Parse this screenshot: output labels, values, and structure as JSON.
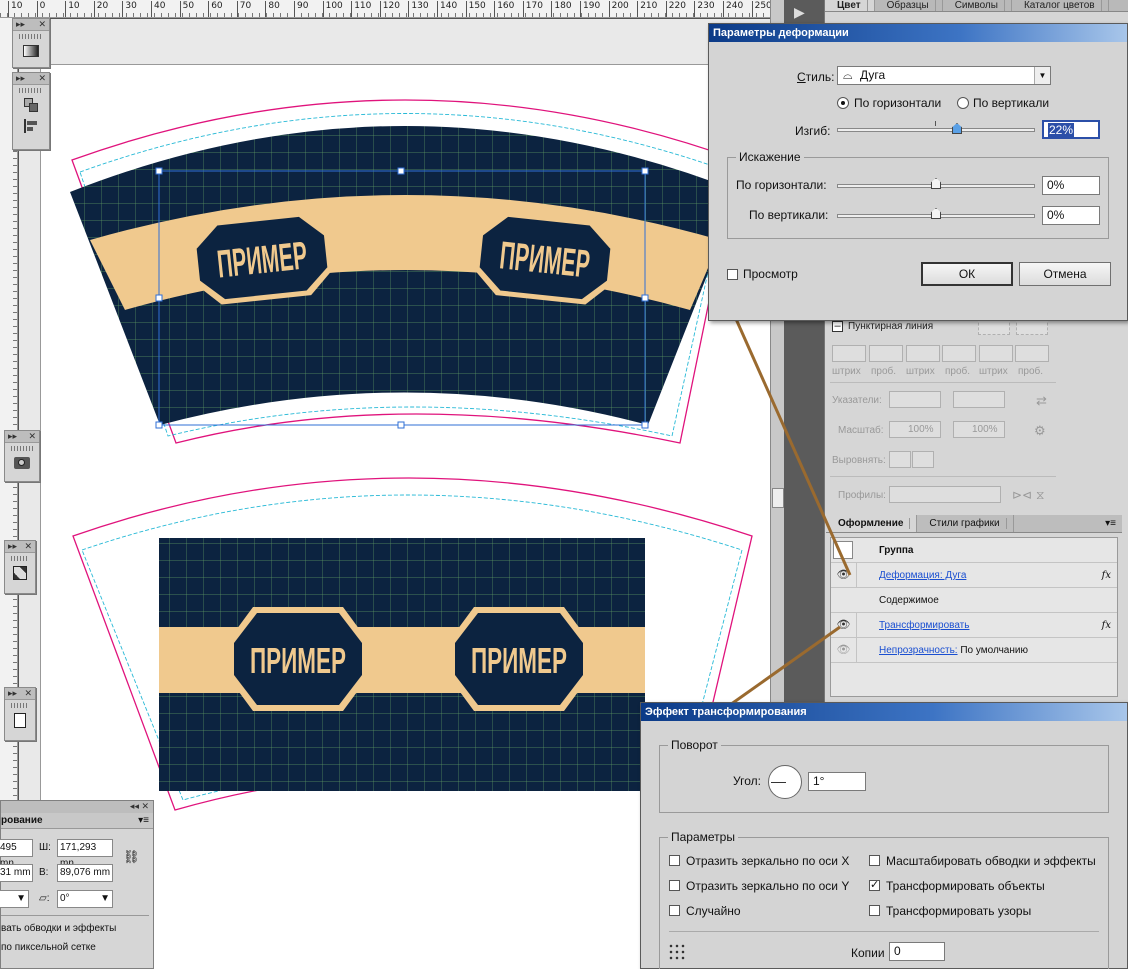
{
  "ruler": {
    "ticks": [
      "10",
      "0",
      "10",
      "20",
      "30",
      "40",
      "50",
      "60",
      "70",
      "80",
      "90",
      "100",
      "110",
      "120",
      "130",
      "140",
      "150",
      "160",
      "170",
      "180",
      "190",
      "200",
      "210",
      "220",
      "230",
      "240",
      "250"
    ]
  },
  "artwork": {
    "label": "ПРИМЕР",
    "colors": {
      "navy": "#0c2340",
      "beige": "#f0c98e",
      "magenta": "#e0137c",
      "cyan": "#27b9d6",
      "grid": "#6fae67",
      "select": "#2f6fd6"
    }
  },
  "panel_top": {
    "tabs": [
      "Цвет",
      "Образцы",
      "Символы",
      "Каталог цветов"
    ]
  },
  "stroke_panel": {
    "dashed_label": "Пунктирная линия",
    "dash_labels": [
      "штрих",
      "проб.",
      "штрих",
      "проб.",
      "штрих",
      "проб."
    ],
    "arrows_label": "Указатели:",
    "scale_label": "Масштаб:",
    "scale_a": "100%",
    "scale_b": "100%",
    "align_label": "Выровнять:",
    "profile_label": "Профилы:"
  },
  "appearance": {
    "tabs": [
      "Оформление",
      "Стили графики"
    ],
    "object": "Группа",
    "effect1_link": "Деформация: Дуга",
    "contents": "Содержимое",
    "effect2_link": "Трансформировать",
    "opacity_link": "Непрозрачность:",
    "opacity_value": "По умолчанию",
    "fx": "fx"
  },
  "warp_dialog": {
    "title": "Параметры деформации",
    "style_label": "Стиль:",
    "style_value": "Дуга",
    "horizontal": "По горизонтали",
    "vertical": "По вертикали",
    "bend_label": "Изгиб:",
    "bend_value": "22%",
    "distortion": "Искажение",
    "dist_h_label": "По горизонтали:",
    "dist_h_value": "0%",
    "dist_v_label": "По вертикали:",
    "dist_v_value": "0%",
    "preview": "Просмотр",
    "ok": "ОК",
    "cancel": "Отмена"
  },
  "transform_dialog": {
    "title": "Эффект трансформирования",
    "rotate_group": "Поворот",
    "angle_label": "Угол:",
    "angle_value": "1°",
    "params_group": "Параметры",
    "reflect_x": "Отразить зеркально по оси X",
    "reflect_y": "Отразить зеркально по оси Y",
    "random": "Случайно",
    "scale_strokes": "Масштабировать обводки и эффекты",
    "transform_objects": "Трансформировать объекты",
    "transform_patterns": "Трансформировать узоры",
    "copies_label": "Копии",
    "copies_value": "0"
  },
  "transform_panel": {
    "tab": "рование",
    "x_val": "495 mn",
    "y_val": "31 mm",
    "w_label": "Ш:",
    "w_val": "171,293 mn",
    "h_label": "В:",
    "h_val": "89,076 mm",
    "shear_val": "0°",
    "opt1": "вать обводки и эффекты",
    "opt2": "по пиксельной сетке"
  }
}
